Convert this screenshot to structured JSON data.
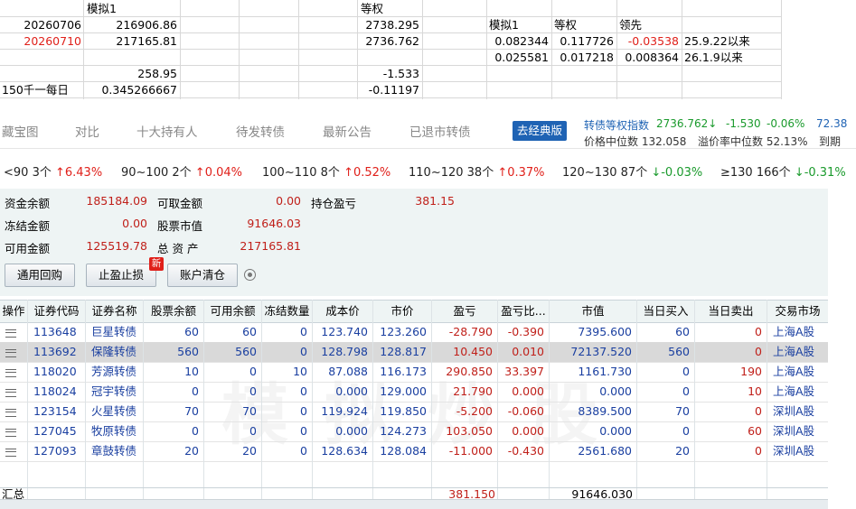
{
  "sheet": {
    "header": {
      "sim": "模拟1",
      "equal": "等权"
    },
    "rows": [
      {
        "date": "20260706",
        "val": "216906.86",
        "eq": "2738.295"
      },
      {
        "date": "20260710",
        "val": "217165.81",
        "eq": "2736.762"
      },
      {
        "date": "",
        "val": "258.95",
        "eq": "-1.533"
      },
      {
        "date": "150千一每日",
        "val": "0.345266667",
        "eq": "-0.11197"
      }
    ],
    "mini": {
      "headers": [
        "模拟1",
        "等权",
        "领先"
      ],
      "rows": [
        {
          "a": "0.082344",
          "b": "0.117726",
          "c": "-0.03538",
          "d": "25.9.22以来"
        },
        {
          "a": "0.025581",
          "b": "0.017218",
          "c": "0.008364",
          "d": "26.1.9以来"
        }
      ]
    }
  },
  "nav": {
    "tabs": [
      "藏宝图",
      "对比",
      "十大持有人",
      "待发转债",
      "最新公告",
      "已退市转债"
    ],
    "classic_btn": "去经典版",
    "index_label": "转债等权指数",
    "index_value": "2736.762↓",
    "index_change": "-1.530",
    "index_pct": "-0.06%",
    "index_extra": "72.38",
    "median_price": "价格中位数 132.058",
    "median_premium": "溢价率中位数 52.13%",
    "expire": "到期"
  },
  "ranges": [
    {
      "label": "<90 3个",
      "pct": "↑6.43%",
      "dir": "up"
    },
    {
      "label": "90~100 2个",
      "pct": "↑0.04%",
      "dir": "up"
    },
    {
      "label": "100~110 8个",
      "pct": "↑0.52%",
      "dir": "up"
    },
    {
      "label": "110~120 38个",
      "pct": "↑0.37%",
      "dir": "up"
    },
    {
      "label": "120~130 87个",
      "pct": "↓-0.03%",
      "dir": "down"
    },
    {
      "label": "≥130 166个",
      "pct": "↓-0.31%",
      "dir": "down"
    }
  ],
  "account": {
    "fund_balance_label": "资金余额",
    "fund_balance": "185184.09",
    "withdrawable_label": "可取金额",
    "withdrawable": "0.00",
    "pnl_label": "持仓盈亏",
    "pnl": "381.15",
    "frozen_label": "冻结金额",
    "frozen": "0.00",
    "stock_value_label": "股票市值",
    "stock_value": "91646.03",
    "available_label": "可用金额",
    "available": "125519.78",
    "total_label": "总 资 产",
    "total": "217165.81",
    "btn_repo": "通用回购",
    "btn_stop": "止盈止损",
    "btn_clear": "账户清仓",
    "new_badge": "新"
  },
  "table": {
    "headers": [
      "操作",
      "证券代码",
      "证券名称",
      "股票余额",
      "可用余额",
      "冻结数量",
      "成本价",
      "市价",
      "盈亏",
      "盈亏比...",
      "市值",
      "当日买入",
      "当日卖出",
      "交易市场"
    ],
    "rows": [
      [
        "113648",
        "巨星转债",
        "60",
        "60",
        "0",
        "123.740",
        "123.260",
        "-28.790",
        "-0.390",
        "7395.600",
        "60",
        "0",
        "上海A股"
      ],
      [
        "113692",
        "保隆转债",
        "560",
        "560",
        "0",
        "128.798",
        "128.817",
        "10.450",
        "0.010",
        "72137.520",
        "560",
        "0",
        "上海A股"
      ],
      [
        "118020",
        "芳源转债",
        "10",
        "0",
        "10",
        "87.088",
        "116.173",
        "290.850",
        "33.397",
        "1161.730",
        "0",
        "190",
        "上海A股"
      ],
      [
        "118024",
        "冠宇转债",
        "0",
        "0",
        "0",
        "0.000",
        "129.000",
        "21.790",
        "0.000",
        "0.000",
        "0",
        "10",
        "上海A股"
      ],
      [
        "123154",
        "火星转债",
        "70",
        "70",
        "0",
        "119.924",
        "119.850",
        "-5.200",
        "-0.060",
        "8389.500",
        "70",
        "0",
        "深圳A股"
      ],
      [
        "127045",
        "牧原转债",
        "0",
        "0",
        "0",
        "0.000",
        "124.273",
        "103.050",
        "0.000",
        "0.000",
        "0",
        "60",
        "深圳A股"
      ],
      [
        "127093",
        "章鼓转债",
        "20",
        "20",
        "0",
        "128.634",
        "128.084",
        "-11.000",
        "-0.430",
        "2561.680",
        "20",
        "0",
        "深圳A股"
      ]
    ],
    "total_label": "汇总",
    "total_pnl": "381.150",
    "total_value": "91646.030",
    "watermark": "模拟炒股"
  }
}
